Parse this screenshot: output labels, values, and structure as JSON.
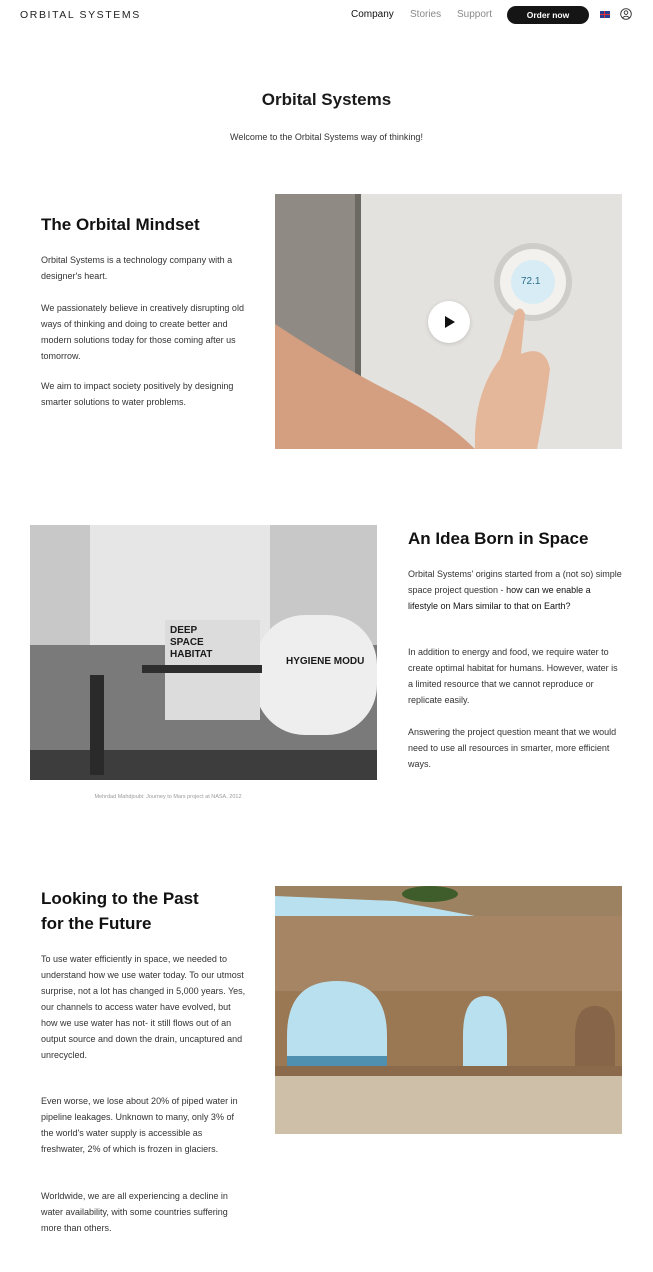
{
  "header": {
    "logo": "ORBITAL SYSTEMS",
    "nav": [
      "Company",
      "Stories",
      "Support"
    ],
    "order_label": "Order now",
    "language_icon": "uk-flag-icon",
    "account_icon": "user-icon"
  },
  "hero": {
    "title": "Orbital Systems",
    "subtitle": "Welcome to the Orbital Systems way of thinking!"
  },
  "mindset": {
    "title": "The Orbital Mindset",
    "paragraphs": [
      "Orbital Systems is a technology company with a designer's heart.",
      "We passionately believe in creatively disrupting old ways of thinking and doing to create better and modern solutions today for those coming after us tomorrow.",
      "We aim to impact society positively by designing smarter solutions to water problems."
    ],
    "video": {
      "thermostat_reading": "72.1",
      "play_icon": "play-icon"
    }
  },
  "space": {
    "title": "An Idea Born in Space",
    "p1_plain": "Orbital Systems' origins started from a (not so) simple space project question - ",
    "p1_strong": "how can we enable a lifestyle on Mars similar to that on Earth?",
    "paragraphs": [
      "In addition to energy and food, we require water to create optimal habitat for humans. However, water is a limited resource that we cannot reproduce or replicate easily.",
      "Answering the project question meant that we would need to use all resources in smarter, more efficient ways."
    ],
    "image_labels": {
      "habitat_sign": "DEEP\nSPACE\nHABITAT",
      "module_sign": "HYGIENE MODU"
    },
    "caption": "Mehrdad Mahdjoubi: Journey to Mars project at NASA, 2012"
  },
  "past": {
    "title_line1": "Looking to the Past",
    "title_line2": "for the Future",
    "paragraphs": [
      "To use water efficiently in space, we needed to understand how we use water today. To our utmost surprise, not a lot has changed in 5,000 years. Yes, our channels to access water have evolved, but how we use water has not- it still flows out of an output source and down the drain, uncaptured and unrecycled.",
      "Even worse, we lose about 20% of piped water in pipeline leakages. Unknown to many, only 3% of the world's water supply is accessible as freshwater, 2% of which is frozen in glaciers.",
      "Worldwide, we are all experiencing a decline in water availability, with some countries suffering more than others."
    ]
  },
  "colors": {
    "text": "#1a1a1a",
    "muted": "#8a8a8a",
    "button": "#151515"
  }
}
